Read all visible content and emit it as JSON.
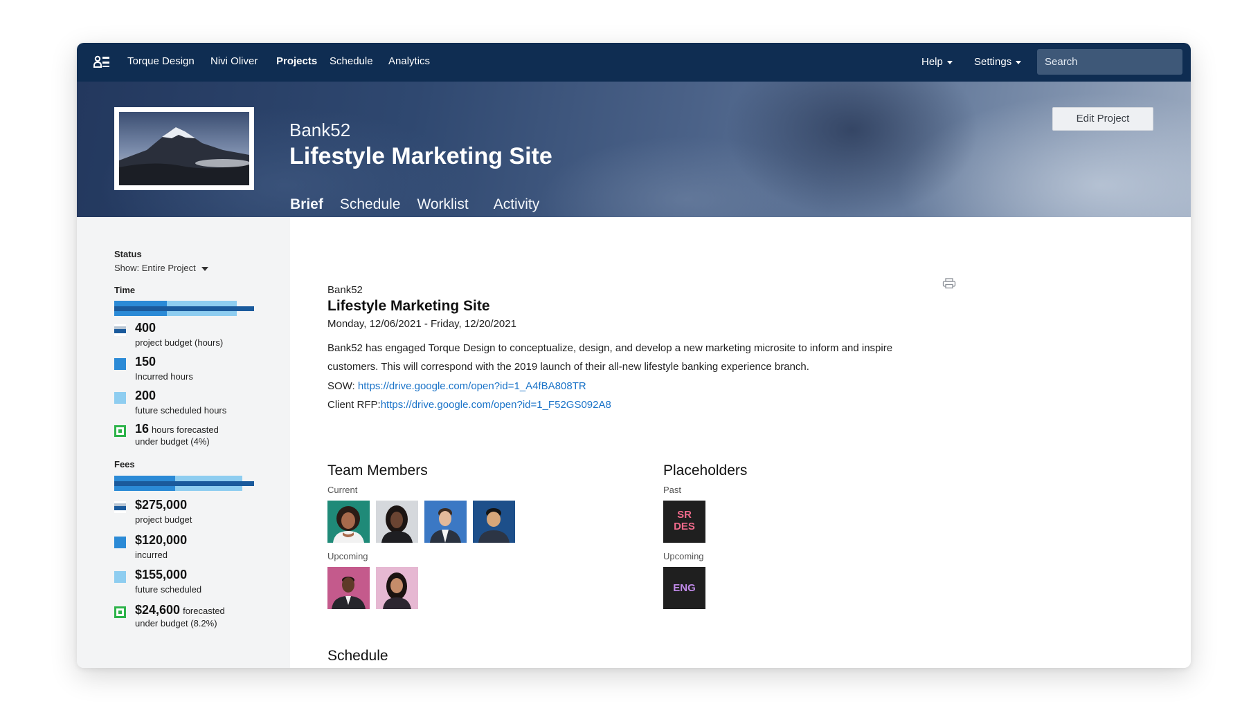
{
  "nav": {
    "brand_icon": "team-icon",
    "company": "Torque Design",
    "user": "Nivi Oliver",
    "projects": "Projects",
    "schedule": "Schedule",
    "analytics": "Analytics",
    "help": "Help",
    "settings": "Settings",
    "search_placeholder": "Search"
  },
  "hero": {
    "client": "Bank52",
    "title": "Lifestyle Marketing Site",
    "edit_button": "Edit Project",
    "tabs": [
      "Brief",
      "Schedule",
      "Worklist",
      "Activity"
    ],
    "active_tab": "Brief"
  },
  "sidebar": {
    "status_label": "Status",
    "show_filter": "Show: Entire Project",
    "time": {
      "label": "Time",
      "budget_value": "400",
      "budget_label": "project budget (hours)",
      "incurred_value": "150",
      "incurred_label": "Incurred hours",
      "future_value": "200",
      "future_label": "future scheduled hours",
      "forecast_value": "16",
      "forecast_label_inline": "hours forecasted",
      "forecast_label_2": "under budget (4%)",
      "incurred_fraction": 0.375,
      "scheduled_fraction": 0.875
    },
    "fees": {
      "label": "Fees",
      "budget_value": "$275,000",
      "budget_label": "project budget",
      "incurred_value": "$120,000",
      "incurred_label": "incurred",
      "future_value": "$155,000",
      "future_label": "future scheduled",
      "forecast_value": "$24,600",
      "forecast_label_inline": "forecasted",
      "forecast_label_2": "under budget (8.2%)",
      "incurred_fraction": 0.436,
      "scheduled_fraction": 0.918
    },
    "colors": {
      "budget_line": "#1a5a9c",
      "incurred": "#2b8ad6",
      "future": "#8ecdf0",
      "forecast": "#2db34a"
    }
  },
  "brief": {
    "client": "Bank52",
    "title": "Lifestyle Marketing Site",
    "dates": "Monday, 12/06/2021 - Friday, 12/20/2021",
    "description": "Bank52 has engaged Torque Design to conceptualize, design, and develop a new marketing microsite to inform and inspire customers. This will correspond with the 2019 launch of their all-new lifestyle banking experience branch.",
    "sow_label": "SOW: ",
    "sow_url": "https://drive.google.com/open?id=1_A4fBA808TR",
    "rfp_label": "Client RFP:",
    "rfp_url": "https://drive.google.com/open?id=1_F52GS092A8",
    "print_icon": "printer-icon"
  },
  "team": {
    "title": "Team Members",
    "current_label": "Current",
    "upcoming_label": "Upcoming"
  },
  "placeholders": {
    "title": "Placeholders",
    "past_label": "Past",
    "past_item_line1": "SR",
    "past_item_line2": "DES",
    "upcoming_label": "Upcoming",
    "upcoming_item": "ENG"
  },
  "schedule": {
    "title": "Schedule"
  }
}
